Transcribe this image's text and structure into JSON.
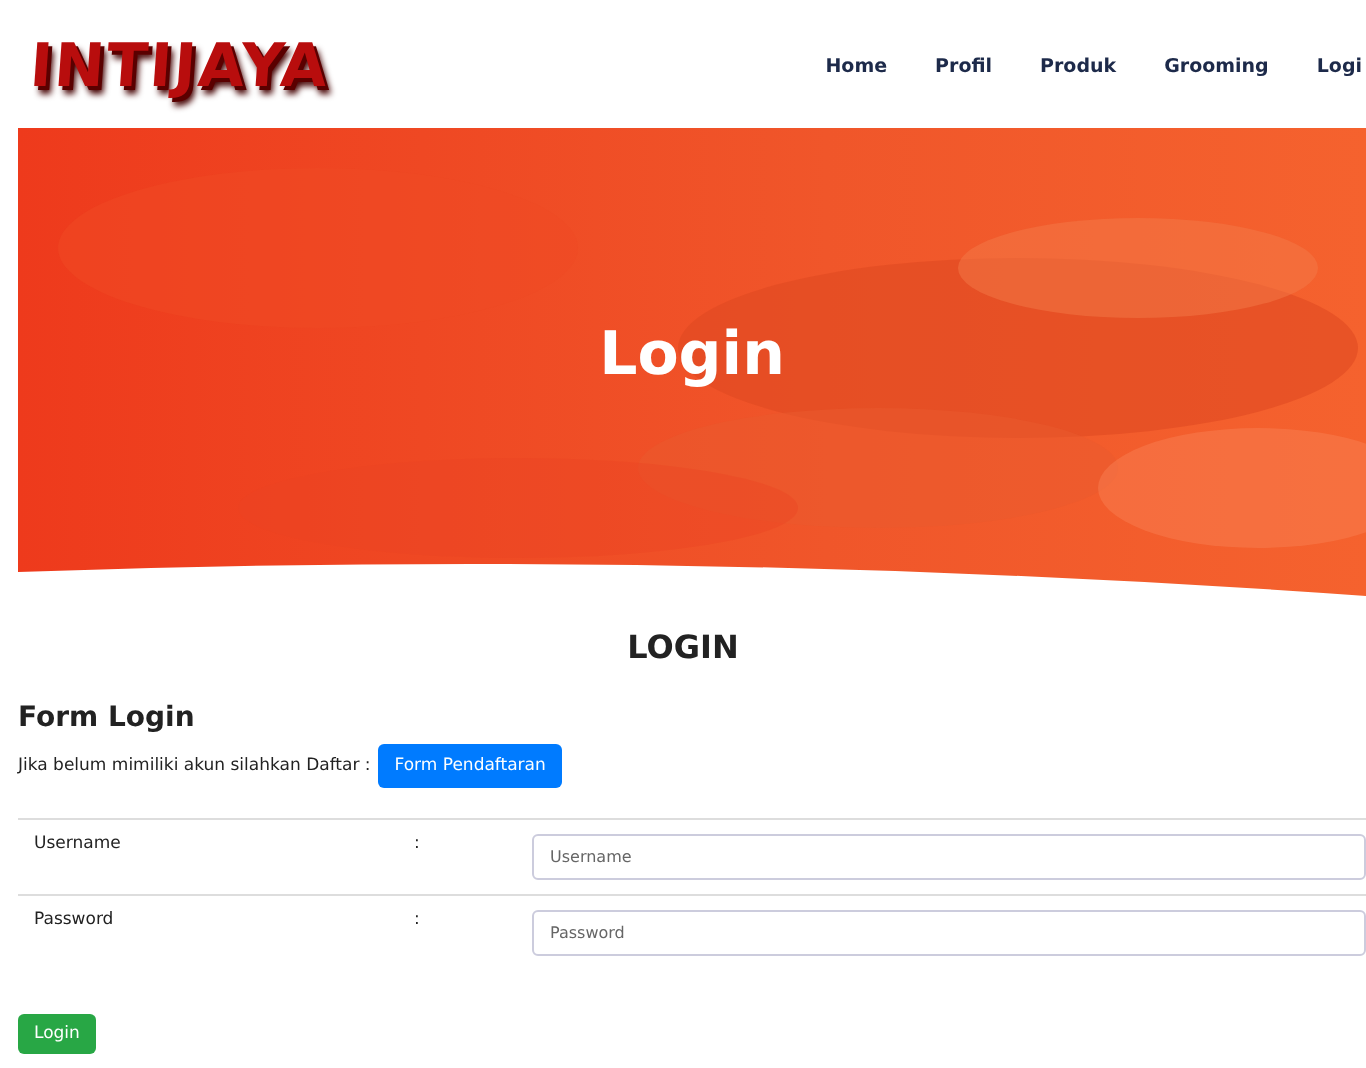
{
  "header": {
    "logo": "INTIJAYA",
    "nav": [
      {
        "label": "Home"
      },
      {
        "label": "Profil"
      },
      {
        "label": "Produk"
      },
      {
        "label": "Grooming"
      },
      {
        "label": "Logi"
      }
    ]
  },
  "hero": {
    "title": "Login"
  },
  "section_title": "LOGIN",
  "form": {
    "title": "Form Login",
    "note": "Jika belum mimiliki akun silahkan Daftar :",
    "register_button": "Form Pendaftaran",
    "fields": [
      {
        "label": "Username",
        "separator": ":",
        "placeholder": "Username"
      },
      {
        "label": "Password",
        "separator": ":",
        "placeholder": "Password"
      }
    ],
    "submit": "Login"
  }
}
